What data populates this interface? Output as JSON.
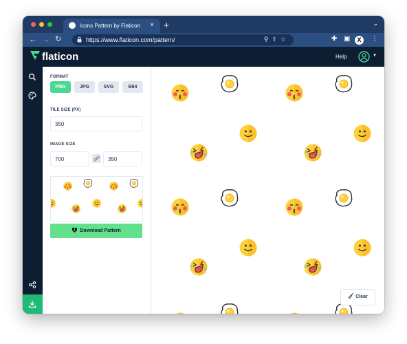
{
  "browser": {
    "tab_title": "Icons Pattern by Flaticon",
    "new_tab": "+",
    "close_tab": "×",
    "url": "https://www.flaticon.com/pattern/",
    "profile_letter": "X"
  },
  "site": {
    "brand": "flaticon",
    "help": "Help"
  },
  "panel": {
    "format_label": "FORMAT",
    "formats": [
      "PNG",
      "JPG",
      "SVG",
      "B64"
    ],
    "selected_format": "PNG",
    "tile_size_label": "TILE SIZE (PX)",
    "tile_size": "350",
    "image_size_label": "IMAGE SIZE",
    "image_width": "700",
    "image_height": "350",
    "download_label": "Download Pattern"
  },
  "canvas": {
    "clear_label": "Clear",
    "icons": [
      "kiss-emoji-icon",
      "fried-egg-icon",
      "smile-emoji-icon",
      "laughing-emoji-icon"
    ]
  },
  "colors": {
    "brand_green": "#4ad991",
    "download_green": "#63e08b",
    "header_navy": "#0e1e32",
    "browser_blue": "#2c4f82",
    "emoji_yellow": "#fdd13a"
  }
}
